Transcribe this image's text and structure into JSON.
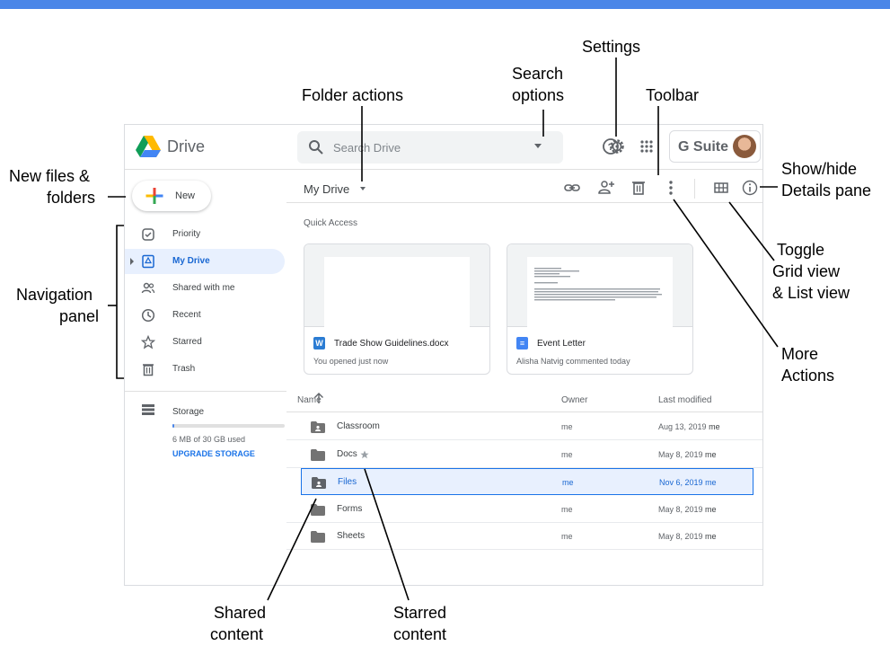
{
  "header": {
    "app_name": "Drive",
    "search_placeholder": "Search Drive",
    "brand": "G Suite",
    "icons": [
      "drive-logo-icon",
      "search-icon",
      "search-options-caret-icon",
      "help-icon",
      "settings-gear-icon",
      "apps-grid-icon",
      "avatar"
    ]
  },
  "sidebar": {
    "new_label": "New",
    "items": [
      {
        "label": "Priority",
        "icon": "priority-check-icon"
      },
      {
        "label": "My Drive",
        "icon": "my-drive-icon",
        "active": true
      },
      {
        "label": "Shared with me",
        "icon": "shared-people-icon"
      },
      {
        "label": "Recent",
        "icon": "clock-icon"
      },
      {
        "label": "Starred",
        "icon": "star-icon"
      },
      {
        "label": "Trash",
        "icon": "trash-icon"
      }
    ],
    "storage": {
      "label": "Storage",
      "used_text": "6 MB of 30 GB used",
      "used_fraction": 0.0002,
      "upgrade_label": "UPGRADE STORAGE"
    }
  },
  "main": {
    "path": "My Drive",
    "toolbar_icons": [
      "link-icon",
      "share-add-person-icon",
      "delete-trash-icon",
      "more-vert-icon",
      "grid-view-icon",
      "info-icon"
    ],
    "quick_access": {
      "title": "Quick Access",
      "cards": [
        {
          "name": "Trade Show Guidelines.docx",
          "subtitle": "You opened just now",
          "badge": "W",
          "badge_color": "#2b7cd3"
        },
        {
          "name": "Event Letter",
          "subtitle": "Alisha Natvig commented today",
          "badge": "≡",
          "badge_color": "#4285f4"
        }
      ]
    },
    "list": {
      "columns": {
        "name": "Name",
        "owner": "Owner",
        "modified": "Last modified"
      },
      "rows": [
        {
          "name": "Classroom",
          "owner": "me",
          "date": "Aug 13, 2019",
          "by": "me",
          "shared": true,
          "starred": false,
          "selected": false
        },
        {
          "name": "Docs",
          "owner": "me",
          "date": "May 8, 2019",
          "by": "me",
          "shared": false,
          "starred": true,
          "selected": false
        },
        {
          "name": "Files",
          "owner": "me",
          "date": "Nov 6, 2019",
          "by": "me",
          "shared": true,
          "starred": false,
          "selected": true
        },
        {
          "name": "Forms",
          "owner": "me",
          "date": "May 8, 2019",
          "by": "me",
          "shared": false,
          "starred": false,
          "selected": false
        },
        {
          "name": "Sheets",
          "owner": "me",
          "date": "May 8, 2019",
          "by": "me",
          "shared": false,
          "starred": false,
          "selected": false
        }
      ]
    }
  },
  "callouts": {
    "settings": "Settings",
    "search_options_1": "Search",
    "search_options_2": "options",
    "folder_actions": "Folder actions",
    "toolbar": "Toolbar",
    "new_files_1": "New files &",
    "new_files_2": "folders",
    "show_hide_1": "Show/hide",
    "show_hide_2": "Details pane",
    "navigation_1": "Navigation",
    "navigation_2": "panel",
    "toggle_1": "Toggle",
    "toggle_2": "Grid view",
    "toggle_3": "& List view",
    "more_actions_1": "More",
    "more_actions_2": "Actions",
    "shared_1": "Shared",
    "shared_2": "content",
    "starred_1": "Starred",
    "starred_2": "content"
  },
  "colors": {
    "accent": "#1a73e8",
    "top_band": "#4a86e8",
    "selection_bg": "#e8f0fe"
  }
}
